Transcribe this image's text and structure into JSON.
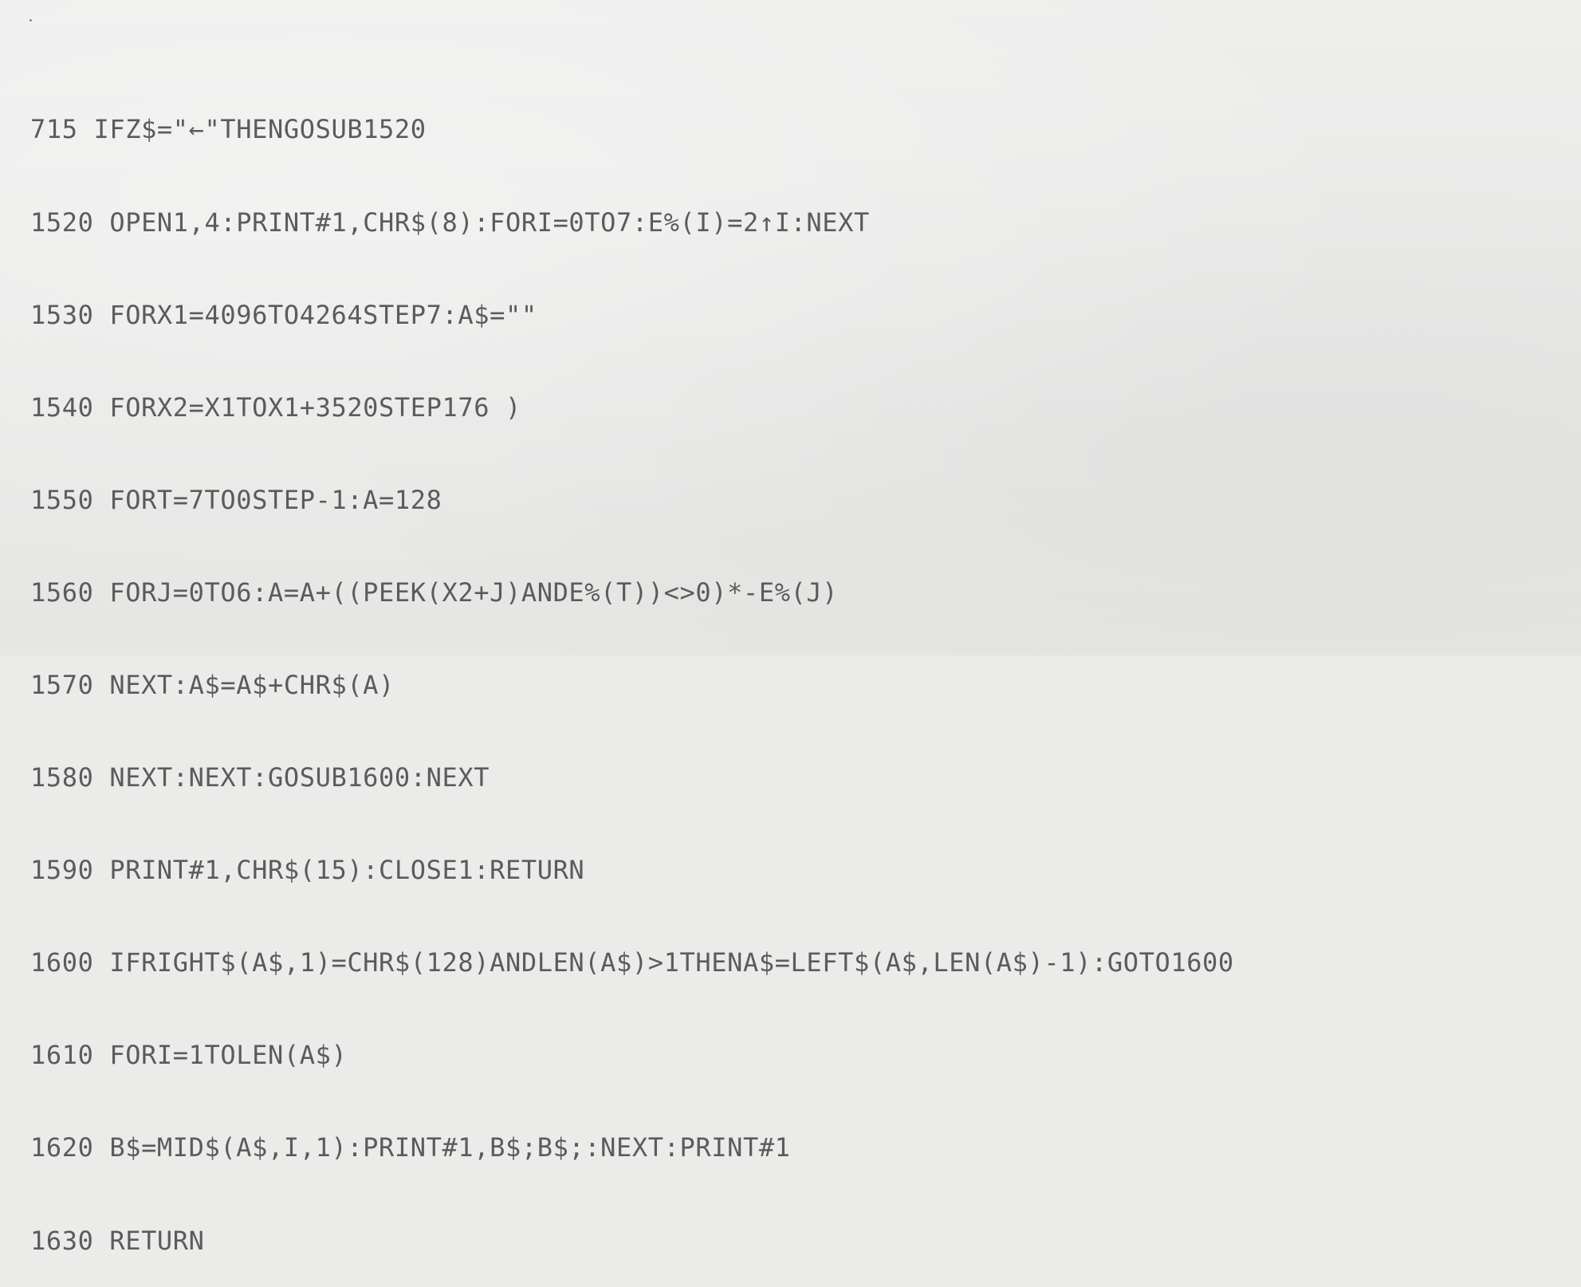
{
  "listing": [
    {
      "num": "715",
      "code": " IFZ$=\"←\"THENGOSUB1520"
    },
    {
      "num": "1520",
      "code": " OPEN1,4:PRINT#1,CHR$(8):FORI=0TO7:E%(I)=2↑I:NEXT"
    },
    {
      "num": "1530",
      "code": " FORX1=4096TO4264STEP7:A$=\"\""
    },
    {
      "num": "1540",
      "code": " FORX2=X1TOX1+3520STEP176 )"
    },
    {
      "num": "1550",
      "code": " FORT=7TO0STEP-1:A=128"
    },
    {
      "num": "1560",
      "code": " FORJ=0TO6:A=A+((PEEK(X2+J)ANDE%(T))<>0)*-E%(J)"
    },
    {
      "num": "1570",
      "code": " NEXT:A$=A$+CHR$(A)"
    },
    {
      "num": "1580",
      "code": " NEXT:NEXT:GOSUB1600:NEXT"
    },
    {
      "num": "1590",
      "code": " PRINT#1,CHR$(15):CLOSE1:RETURN"
    },
    {
      "num": "1600",
      "code": " IFRIGHT$(A$,1)=CHR$(128)ANDLEN(A$)>1THENA$=LEFT$(A$,LEN(A$)-1):GOTO1600"
    },
    {
      "num": "1610",
      "code": " FORI=1TOLEN(A$)"
    },
    {
      "num": "1620",
      "code": " B$=MID$(A$,I,1):PRINT#1,B$;B$;:NEXT:PRINT#1"
    },
    {
      "num": "1630",
      "code": " RETURN"
    }
  ]
}
